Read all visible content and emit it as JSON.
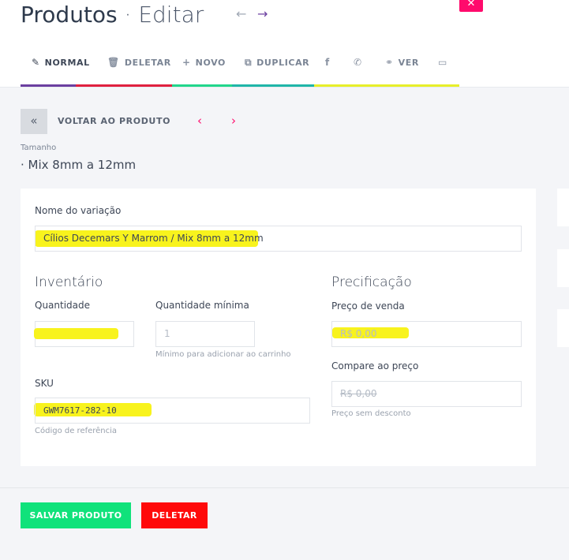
{
  "header": {
    "title": "Produtos",
    "separator": " · ",
    "subtitle": "Editar",
    "prev_arrow": "←",
    "next_arrow": "→",
    "close_glyph": "✕"
  },
  "toolbar": {
    "items": [
      {
        "label": "NORMAL",
        "icon": "✎",
        "icon_name": "edit-icon"
      },
      {
        "label": "DELETAR",
        "icon": "🗑",
        "icon_name": "trash-icon"
      },
      {
        "label": "NOVO",
        "icon": "+",
        "icon_name": "plus-icon"
      },
      {
        "label": "DUPLICAR",
        "icon": "⧉",
        "icon_name": "copy-icon"
      },
      {
        "label": "",
        "icon": "f",
        "icon_name": "facebook-icon"
      },
      {
        "label": "",
        "icon": "✆",
        "icon_name": "whatsapp-icon"
      },
      {
        "label": "VER",
        "icon": "⚭",
        "icon_name": "link-icon"
      },
      {
        "label": "",
        "icon": "▭",
        "icon_name": "card-icon"
      }
    ],
    "bar_colors": [
      "#6b3fa0",
      "#e0203f",
      "#22d68c",
      "#1fb5a8",
      "#e7ef2a"
    ]
  },
  "back": {
    "icon": "«",
    "label": "VOLTAR AO PRODUTO",
    "prev": "‹",
    "next": "›"
  },
  "tamanho": {
    "label": "Tamanho",
    "value": "· Mix 8mm a 12mm"
  },
  "form": {
    "name_label": "Nome do variação",
    "name_value": "Cílios Decemars Y Marrom / Mix 8mm a 12mm",
    "inventory_title": "Inventário",
    "quantity_label": "Quantidade",
    "quantity_value": "",
    "min_quantity_label": "Quantidade mínima",
    "min_quantity_placeholder": "1",
    "min_quantity_help": "Mínimo para adicionar ao carrinho",
    "sku_label": "SKU",
    "sku_value": "GWM7617-282-10",
    "sku_help": "Código de referência",
    "pricing_title": "Precificação",
    "price_label": "Preço de venda",
    "price_value": "R$ 0,00",
    "compare_label": "Compare ao preço",
    "compare_value": "R$ 0,00",
    "compare_help": "Preço sem desconto"
  },
  "footer": {
    "save_label": "SALVAR PRODUTO",
    "delete_label": "DELETAR"
  },
  "colors": {
    "accent_pink": "#ff0a6c",
    "save_green": "#10e27b",
    "delete_red": "#ff0a0a",
    "highlight_yellow": "#f7f20a"
  }
}
